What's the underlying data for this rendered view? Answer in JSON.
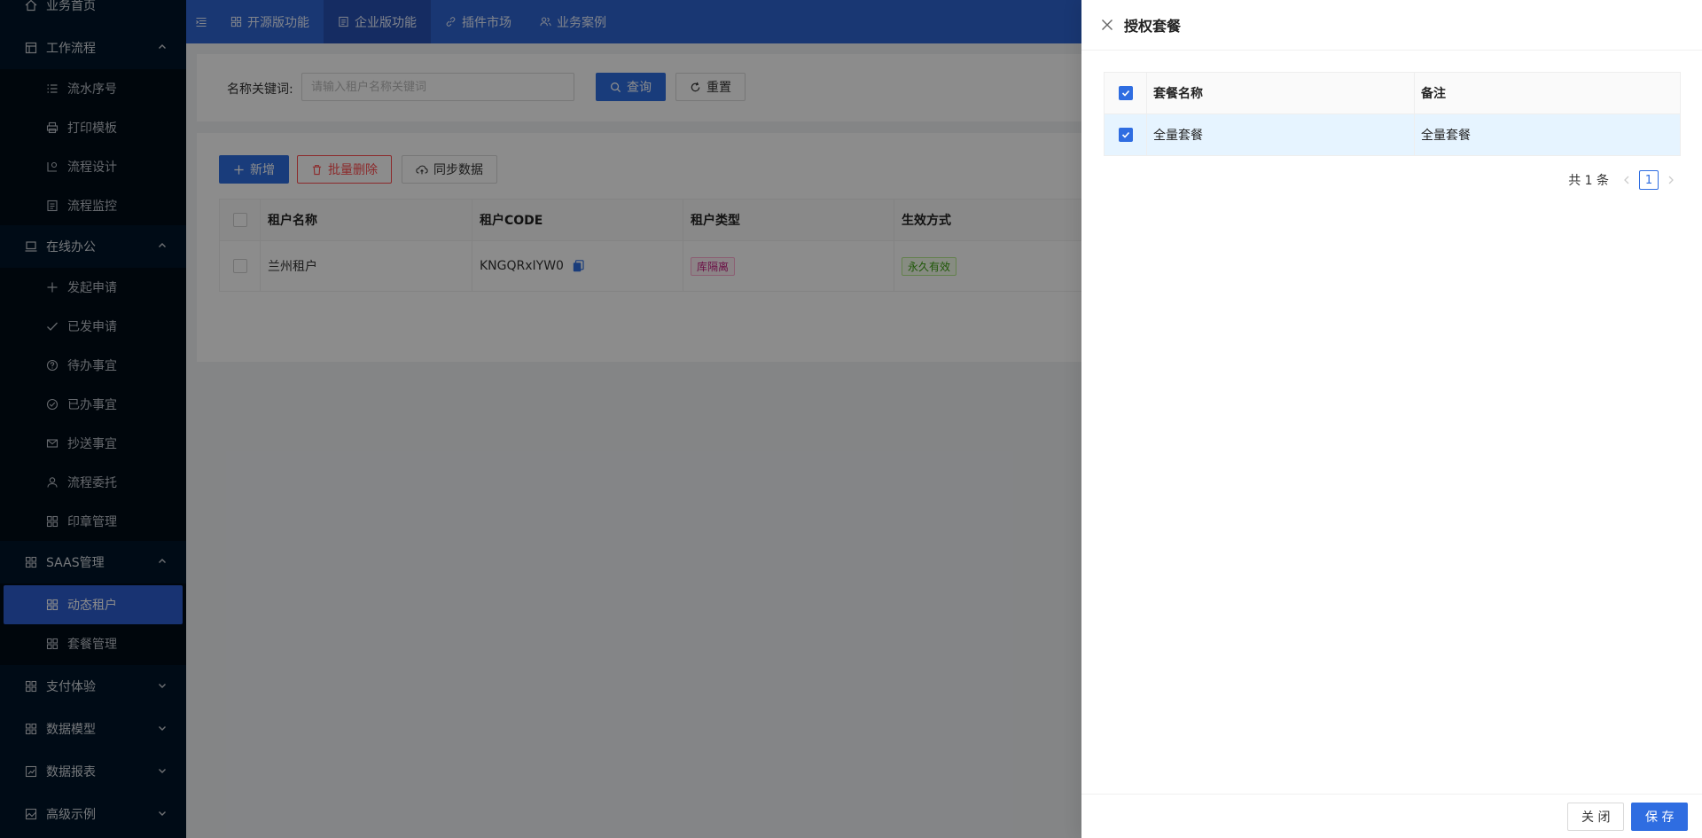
{
  "sidebar": {
    "items": [
      {
        "type": "group",
        "label": "业务首页",
        "icon": "home-icon"
      },
      {
        "type": "group",
        "label": "工作流程",
        "icon": "layout-icon",
        "expanded": true
      },
      {
        "type": "item",
        "label": "流水序号",
        "icon": "list-icon"
      },
      {
        "type": "item",
        "label": "打印模板",
        "icon": "printer-icon"
      },
      {
        "type": "item",
        "label": "流程设计",
        "icon": "flow-icon"
      },
      {
        "type": "item",
        "label": "流程监控",
        "icon": "document-icon"
      },
      {
        "type": "group",
        "label": "在线办公",
        "icon": "laptop-icon",
        "expanded": true
      },
      {
        "type": "item",
        "label": "发起申请",
        "icon": "plus-icon"
      },
      {
        "type": "item",
        "label": "已发申请",
        "icon": "check-icon"
      },
      {
        "type": "item",
        "label": "待办事宜",
        "icon": "question-circle-icon"
      },
      {
        "type": "item",
        "label": "已办事宜",
        "icon": "check-circle-icon"
      },
      {
        "type": "item",
        "label": "抄送事宜",
        "icon": "mail-icon"
      },
      {
        "type": "item",
        "label": "流程委托",
        "icon": "user-icon"
      },
      {
        "type": "item",
        "label": "印章管理",
        "icon": "grid-icon"
      },
      {
        "type": "group",
        "label": "SAAS管理",
        "icon": "grid-icon",
        "expanded": true
      },
      {
        "type": "item",
        "label": "动态租户",
        "icon": "grid-icon",
        "active": true
      },
      {
        "type": "item",
        "label": "套餐管理",
        "icon": "grid-icon"
      },
      {
        "type": "group",
        "label": "支付体验",
        "icon": "grid-icon",
        "expanded": false
      },
      {
        "type": "group",
        "label": "数据模型",
        "icon": "grid-icon",
        "expanded": false
      },
      {
        "type": "group",
        "label": "数据报表",
        "icon": "report-icon",
        "expanded": false
      },
      {
        "type": "group",
        "label": "高级示例",
        "icon": "image-icon",
        "expanded": false
      }
    ]
  },
  "topbar": {
    "tabs": [
      {
        "label": "开源版功能",
        "icon": "apps-icon",
        "active": false
      },
      {
        "label": "企业版功能",
        "icon": "document-icon",
        "active": true
      },
      {
        "label": "插件市场",
        "icon": "link-icon",
        "active": false
      },
      {
        "label": "业务案例",
        "icon": "users-icon",
        "active": false
      }
    ]
  },
  "search": {
    "label": "名称关键词:",
    "placeholder": "请输入租户名称关键词",
    "query_label": "查询",
    "reset_label": "重置"
  },
  "toolbar": {
    "add_label": "新增",
    "batch_delete_label": "批量删除",
    "sync_label": "同步数据"
  },
  "tenant_table": {
    "headers": [
      "租户名称",
      "租户CODE",
      "租户类型",
      "生效方式"
    ],
    "rows": [
      {
        "name": "兰州租户",
        "code": "KNGQRxIYW0",
        "type": "库隔离",
        "effect": "永久有效"
      }
    ]
  },
  "drawer": {
    "title": "授权套餐",
    "headers": [
      "套餐名称",
      "备注"
    ],
    "rows": [
      {
        "name": "全量套餐",
        "remark": "全量套餐",
        "checked": true
      }
    ],
    "total_text": "共 1 条",
    "current_page": "1",
    "close_label": "关 闭",
    "save_label": "保 存"
  },
  "colors": {
    "sidebar_bg": "#001529",
    "primary": "#2f6de1",
    "topbar_bg": "#2f64d2",
    "danger": "#ff4d4f",
    "selected_row": "#e6f4ff"
  }
}
